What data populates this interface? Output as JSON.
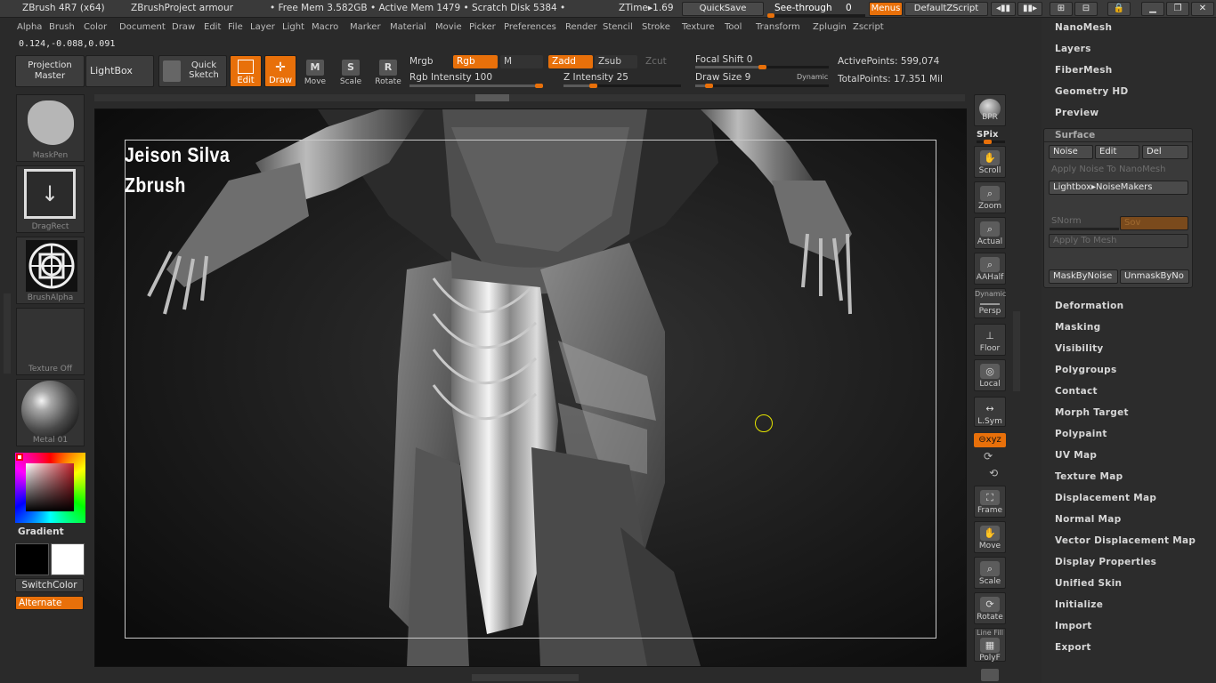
{
  "titlebar": {
    "app_title": "ZBrush 4R7 (x64)",
    "project": "ZBrushProject armour",
    "stats": "• Free Mem 3.582GB • Active Mem 1479 • Scratch Disk 5384 •",
    "ztime": "ZTime▸1.69",
    "quicksave": "QuickSave",
    "seethrough_label": "See-through",
    "seethrough_value": "0",
    "seethrough_level": 0,
    "menus": "Menus",
    "default_zscript": "DefaultZScript"
  },
  "menubar": [
    "Alpha",
    "Brush",
    "Color",
    "Document",
    "Draw",
    "Edit",
    "File",
    "Layer",
    "Light",
    "Macro",
    "Marker",
    "Material",
    "Movie",
    "Picker",
    "Preferences",
    "Render",
    "Stencil",
    "Stroke",
    "Texture",
    "Tool",
    "Transform",
    "Zplugin",
    "Zscript"
  ],
  "coords": "0.124,-0.088,0.091",
  "shelf": {
    "projection_master": "Projection Master",
    "lightbox": "LightBox",
    "quick_sketch": "Quick Sketch",
    "edit": "Edit",
    "draw": "Draw",
    "move": "Move",
    "scale": "Scale",
    "rotate": "Rotate",
    "mrgb": "Mrgb",
    "rgb": "Rgb",
    "m": "M",
    "zadd": "Zadd",
    "zsub": "Zsub",
    "zcut": "Zcut",
    "rgb_intensity": "Rgb Intensity 100",
    "rgb_intensity_level": 1.0,
    "z_intensity": "Z Intensity 25",
    "z_intensity_level": 0.25,
    "focal_shift": "Focal Shift 0",
    "focal_shift_level": 0.5,
    "draw_size": "Draw Size 9",
    "draw_size_level": 0.1,
    "dynamic": "Dynamic",
    "active_points": "ActivePoints: 599,074",
    "total_points": "TotalPoints: 17.351 Mil"
  },
  "left_tray": {
    "brush": "MaskPen",
    "stroke": "DragRect",
    "alpha": "BrushAlpha",
    "texture": "Texture Off",
    "material": "Metal 01",
    "gradient": "Gradient",
    "switch_color": "SwitchColor",
    "alternate": "Alternate"
  },
  "canvas": {
    "watermark_line1": "Jeison Silva",
    "watermark_line2": "Zbrush"
  },
  "right_tools": {
    "bpr": "BPR",
    "spix": "SPix",
    "scroll": "Scroll",
    "zoom": "Zoom",
    "actual": "Actual",
    "aahalf": "AAHalf",
    "dynamic": "Dynamic",
    "persp": "Persp",
    "floor": "Floor",
    "local": "Local",
    "lsym": "L.Sym",
    "xyz": "⊖xyz",
    "frame": "Frame",
    "move": "Move",
    "scale": "Scale",
    "rotate": "Rotate",
    "line_fill": "Line Fill",
    "polyf": "PolyF"
  },
  "palette": {
    "top_items": [
      "NanoMesh",
      "Layers",
      "FiberMesh",
      "Geometry HD",
      "Preview"
    ],
    "surface": {
      "title": "Surface",
      "noise": "Noise",
      "edit": "Edit",
      "del": "Del",
      "apply_noise": "Apply Noise To NanoMesh",
      "lightbox_noisemakers": "Lightbox▸NoiseMakers",
      "snorm": "SNorm",
      "sov": "Sov",
      "apply_to_mesh": "Apply To Mesh",
      "mask_by_noise": "MaskByNoise",
      "unmask_by_noise": "UnmaskByNo"
    },
    "bottom_items": [
      "Deformation",
      "Masking",
      "Visibility",
      "Polygroups",
      "Contact",
      "Morph Target",
      "Polypaint",
      "UV Map",
      "Texture Map",
      "Displacement Map",
      "Normal Map",
      "Vector Displacement Map",
      "Display Properties",
      "Unified Skin",
      "Initialize",
      "Import",
      "Export"
    ]
  },
  "colors": {
    "accent": "#e8700a",
    "panel": "#2c2c2c",
    "background": "#2a2a2a"
  }
}
